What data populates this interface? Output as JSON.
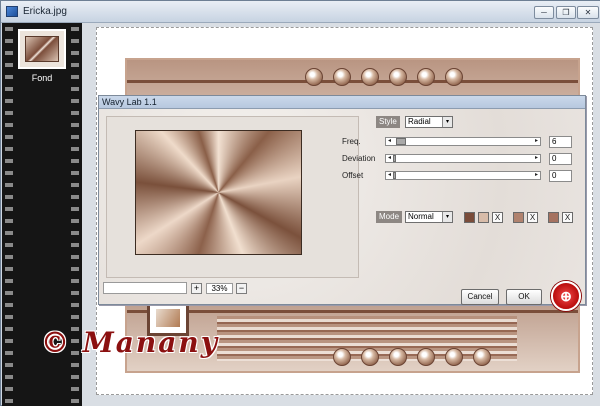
{
  "window": {
    "title": "Ericka.jpg",
    "minimize": "─",
    "restore": "❐",
    "close": "✕"
  },
  "filmstrip": {
    "layer_label": "Fond"
  },
  "dialog": {
    "title": "Wavy Lab 1.1",
    "style_label": "Style",
    "style_value": "Radial",
    "params": [
      {
        "label": "Freq.",
        "value": "6",
        "level": 0.05
      },
      {
        "label": "Deviation",
        "value": "0",
        "level": 0
      },
      {
        "label": "Offset",
        "value": "0",
        "level": 0
      }
    ],
    "mode_label": "Mode",
    "mode_value": "Normal",
    "swatches": [
      "#7a4c3a",
      "#d8bca9",
      "#b0826e",
      "#a57260"
    ],
    "zoom": {
      "plus": "+",
      "value": "33%",
      "minus": "−"
    },
    "cancel_label": "Cancel",
    "ok_label": "OK",
    "dropdown_arrow": "▾",
    "remove_glyph": "X"
  },
  "watermark": "© Manany",
  "icons": [
    "app-icon",
    "minimize-icon",
    "restore-icon",
    "close-icon",
    "filter-logo-icon"
  ]
}
